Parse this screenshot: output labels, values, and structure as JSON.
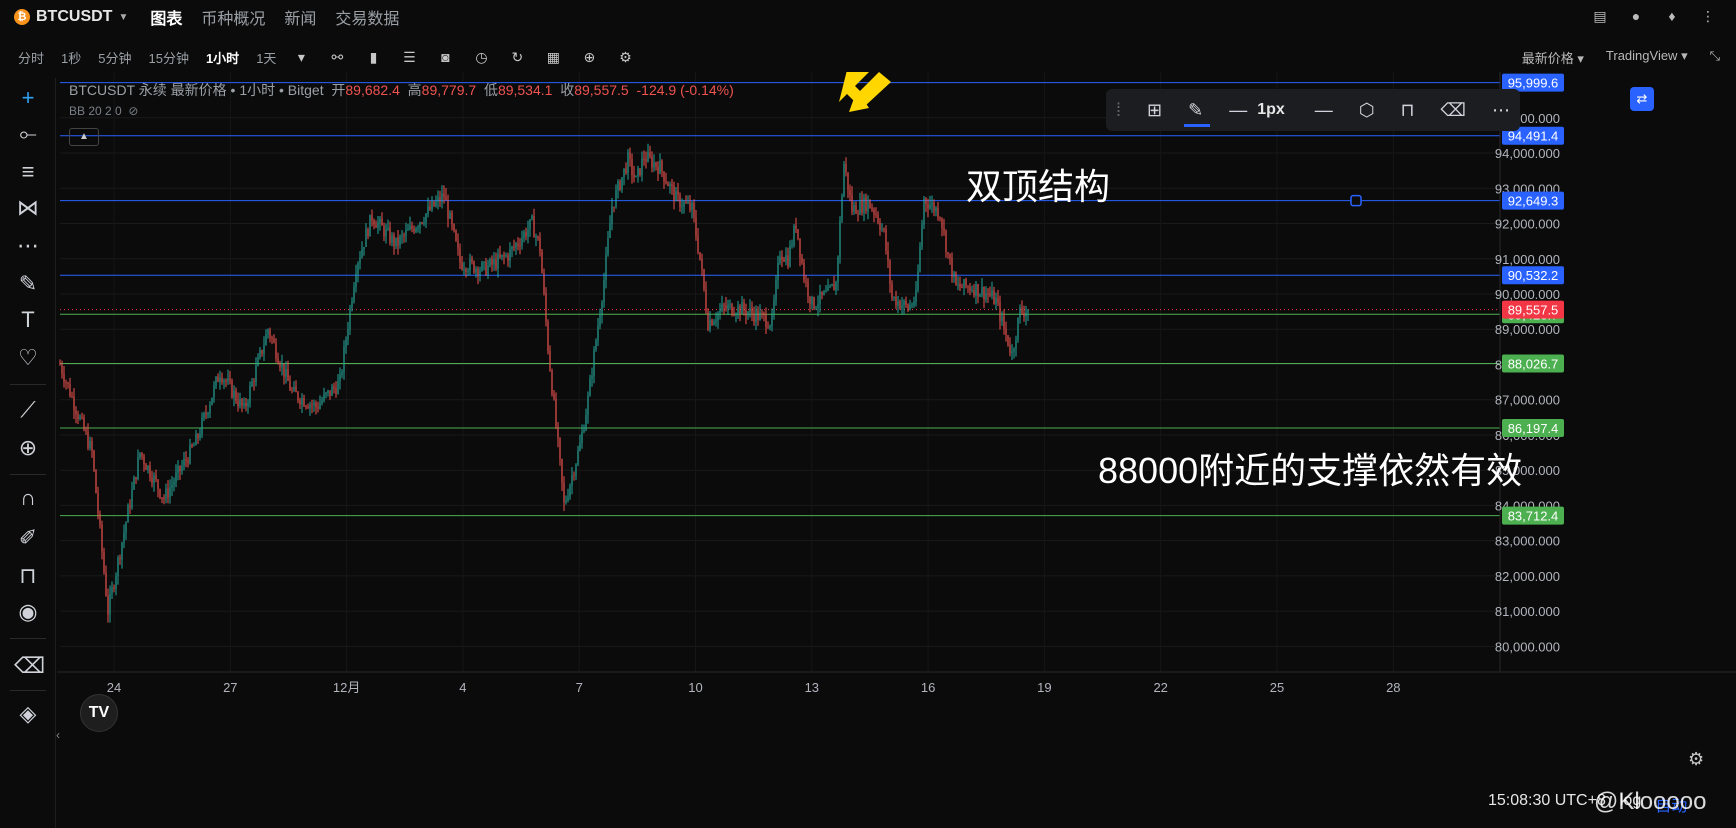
{
  "topbar": {
    "symbol": "BTCUSDT",
    "tabs": [
      "图表",
      "币种概况",
      "新闻",
      "交易数据"
    ],
    "active_tab": 0
  },
  "toolbar": {
    "timeframes": [
      "分时",
      "1秒",
      "5分钟",
      "15分钟",
      "1小时",
      "1天"
    ],
    "active_timeframe": 4,
    "price_type": "最新价格",
    "provider": "TradingView"
  },
  "legend": {
    "title": "BTCUSDT 永续 最新价格 • 1小时 • Bitget",
    "open_label": "开",
    "open": "89,682.4",
    "high_label": "高",
    "high": "89,779.7",
    "low_label": "低",
    "low": "89,534.1",
    "close_label": "收",
    "close": "89,557.5",
    "change": "-124.9 (-0.14%)",
    "indicator": "BB 20 2 0"
  },
  "drawing_toolbar": {
    "width_label": "1px"
  },
  "annotations": {
    "double_top": "双顶结构",
    "support": "88000附近的支撑依然有效"
  },
  "status": {
    "time": "15:08:30 UTC+8",
    "log": "log",
    "auto": "自动"
  },
  "watermark": "@Klooooo",
  "colors": {
    "up": "#26a69a",
    "down": "#ef5350",
    "hline_blue": "#2962ff",
    "hline_green": "#4caf50",
    "last_price": "#f23645",
    "arrow": "#ffd600"
  },
  "chart_data": {
    "type": "candlestick",
    "y_range": [
      79500,
      96300
    ],
    "y_ticks": [
      80000,
      81000,
      82000,
      83000,
      84000,
      85000,
      86000,
      87000,
      88000,
      89000,
      90000,
      91000,
      92000,
      93000,
      94000,
      95000
    ],
    "x_tick_labels": [
      "24",
      "27",
      "12月",
      "4",
      "7",
      "10",
      "13",
      "16",
      "19",
      "22",
      "25",
      "28"
    ],
    "blue_levels": [
      95999.6,
      94491.4,
      92649.3,
      90532.2
    ],
    "green_levels": [
      89423.7,
      88026.7,
      86197.4,
      83712.4
    ],
    "last_price": 89557.5,
    "path": [
      [
        0,
        88000
      ],
      [
        4,
        85500
      ],
      [
        6,
        81000
      ],
      [
        10,
        85500
      ],
      [
        13,
        84200
      ],
      [
        17,
        85800
      ],
      [
        20,
        87800
      ],
      [
        23,
        86700
      ],
      [
        26,
        89000
      ],
      [
        29,
        87200
      ],
      [
        32,
        86800
      ],
      [
        35,
        87500
      ],
      [
        37,
        90800
      ],
      [
        39,
        92200
      ],
      [
        42,
        91400
      ],
      [
        45,
        92100
      ],
      [
        48,
        92800
      ],
      [
        50,
        90900
      ],
      [
        53,
        90700
      ],
      [
        56,
        91100
      ],
      [
        59,
        92000
      ],
      [
        60,
        91300
      ],
      [
        61,
        88500
      ],
      [
        63,
        84000
      ],
      [
        65,
        85700
      ],
      [
        66,
        87000
      ],
      [
        68,
        90400
      ],
      [
        69,
        92500
      ],
      [
        71,
        93800
      ],
      [
        72,
        93200
      ],
      [
        73,
        93900
      ],
      [
        75,
        93600
      ],
      [
        77,
        92700
      ],
      [
        79,
        92400
      ],
      [
        80,
        91000
      ],
      [
        81,
        89200
      ],
      [
        83,
        89600
      ],
      [
        85,
        89600
      ],
      [
        87,
        89400
      ],
      [
        89,
        89200
      ],
      [
        90,
        91200
      ],
      [
        91,
        91000
      ],
      [
        92,
        92000
      ],
      [
        93,
        90500
      ],
      [
        94,
        89700
      ],
      [
        96,
        90000
      ],
      [
        97,
        90300
      ],
      [
        98,
        93700
      ],
      [
        99,
        92400
      ],
      [
        101,
        92600
      ],
      [
        102,
        92300
      ],
      [
        103,
        91700
      ],
      [
        104,
        89900
      ],
      [
        106,
        89600
      ],
      [
        107,
        89900
      ],
      [
        108,
        92700
      ],
      [
        110,
        92300
      ],
      [
        111,
        91100
      ],
      [
        112,
        90200
      ],
      [
        114,
        90200
      ],
      [
        116,
        90000
      ],
      [
        117,
        89800
      ],
      [
        118,
        89000
      ],
      [
        119,
        88300
      ],
      [
        120,
        89500
      ],
      [
        121,
        89557.5
      ]
    ],
    "max_hourly_index": 121,
    "x_index_range": [
      0,
      180
    ]
  }
}
